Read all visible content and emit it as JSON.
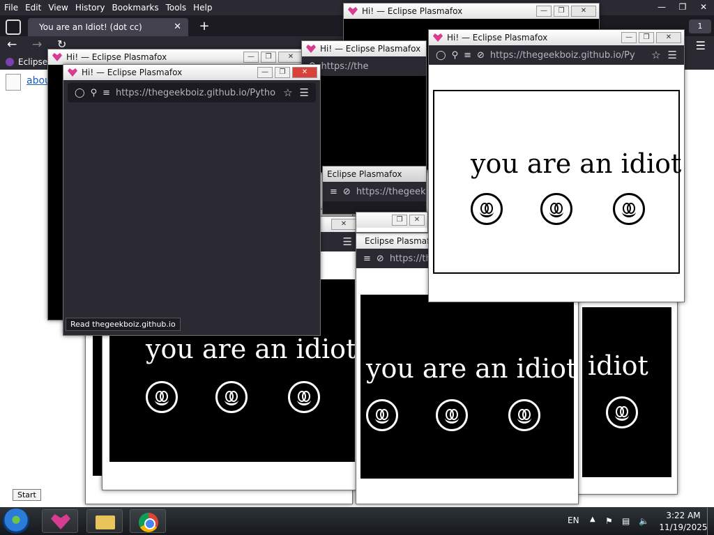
{
  "main_browser": {
    "menu": [
      "File",
      "Edit",
      "View",
      "History",
      "Bookmarks",
      "Tools",
      "Help"
    ],
    "active_tab_title": "You are an Idiot! (dot cc)",
    "url": "https://thegeekboiz.github.io",
    "bookmark_label": "Eclipse",
    "page_link": "abou",
    "tab_count": "1"
  },
  "popups": {
    "title": "Hi! — Eclipse Plasmafox",
    "title_partial": "Eclipse Plasmafox",
    "title_partial2": "Eclipse Plasmafox",
    "url_full": "https://thegeekboiz.github.io/Py",
    "url_front": "https://thegeekboiz.github.io/Pytho",
    "url_short": "https://thegeekb",
    "url_mid": "https://the",
    "url_bottom": "https://thegeekboiz.github.io/Py",
    "message": "you are an idiot",
    "message_partial": "idiot",
    "status_tooltip": "Read thegeekboiz.github.io"
  },
  "colors": {
    "chrome_dark": "#1c1b22",
    "toolbar": "#2b2a33",
    "accent_logo": "#d63c8f",
    "link": "#1a5fb4"
  },
  "taskbar": {
    "start_tooltip": "Start",
    "apps": [
      "Eclipse Plasmafox",
      "File Explorer",
      "Google Chrome"
    ],
    "language": "EN",
    "time": "3:22 AM",
    "date": "11/19/2025"
  }
}
